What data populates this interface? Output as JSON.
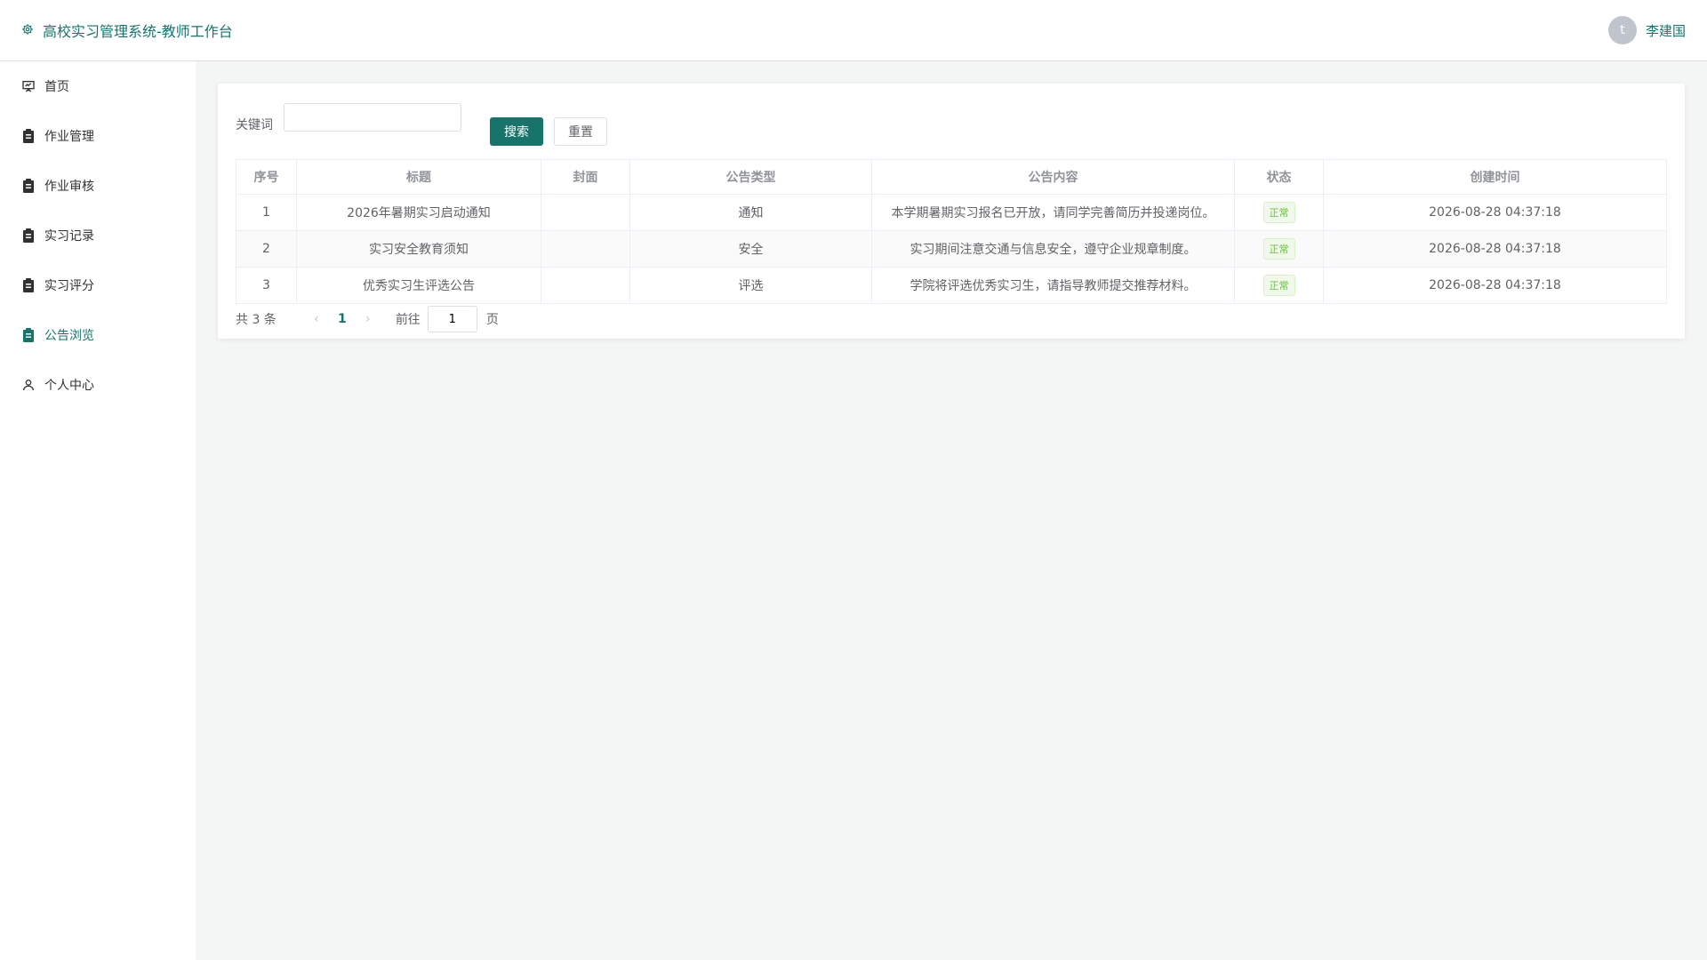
{
  "header": {
    "title": "高校实习管理系统-教师工作台",
    "avatar_letter": "t",
    "user_name": "李建国"
  },
  "sidebar": {
    "items": [
      {
        "label": "首页",
        "icon": "presentation-icon"
      },
      {
        "label": "作业管理",
        "icon": "clipboard-icon"
      },
      {
        "label": "作业审核",
        "icon": "clipboard-icon"
      },
      {
        "label": "实习记录",
        "icon": "clipboard-icon"
      },
      {
        "label": "实习评分",
        "icon": "clipboard-icon"
      },
      {
        "label": "公告浏览",
        "icon": "clipboard-icon",
        "active": true
      },
      {
        "label": "个人中心",
        "icon": "user-icon"
      }
    ]
  },
  "search": {
    "label": "关键词",
    "value": "",
    "placeholder": "",
    "search_button": "搜索",
    "reset_button": "重置"
  },
  "table": {
    "columns": [
      "序号",
      "标题",
      "封面",
      "公告类型",
      "公告内容",
      "状态",
      "创建时间"
    ],
    "rows": [
      {
        "index": "1",
        "title": "2026年暑期实习启动通知",
        "cover": "",
        "type": "通知",
        "content": "本学期暑期实习报名已开放，请同学完善简历并投递岗位。",
        "status": "正常",
        "created": "2026-08-28 04:37:18"
      },
      {
        "index": "2",
        "title": "实习安全教育须知",
        "cover": "",
        "type": "安全",
        "content": "实习期间注意交通与信息安全，遵守企业规章制度。",
        "status": "正常",
        "created": "2026-08-28 04:37:18"
      },
      {
        "index": "3",
        "title": "优秀实习生评选公告",
        "cover": "",
        "type": "评选",
        "content": "学院将评选优秀实习生，请指导教师提交推荐材料。",
        "status": "正常",
        "created": "2026-08-28 04:37:18"
      }
    ]
  },
  "pagination": {
    "total": "共 3 条",
    "prev": "‹",
    "current_page": "1",
    "next": "›",
    "goto_label": "前往",
    "goto_value": "1",
    "goto_suffix": "页"
  },
  "colors": {
    "accent": "#17746a",
    "tag_green": "#67c23a"
  }
}
